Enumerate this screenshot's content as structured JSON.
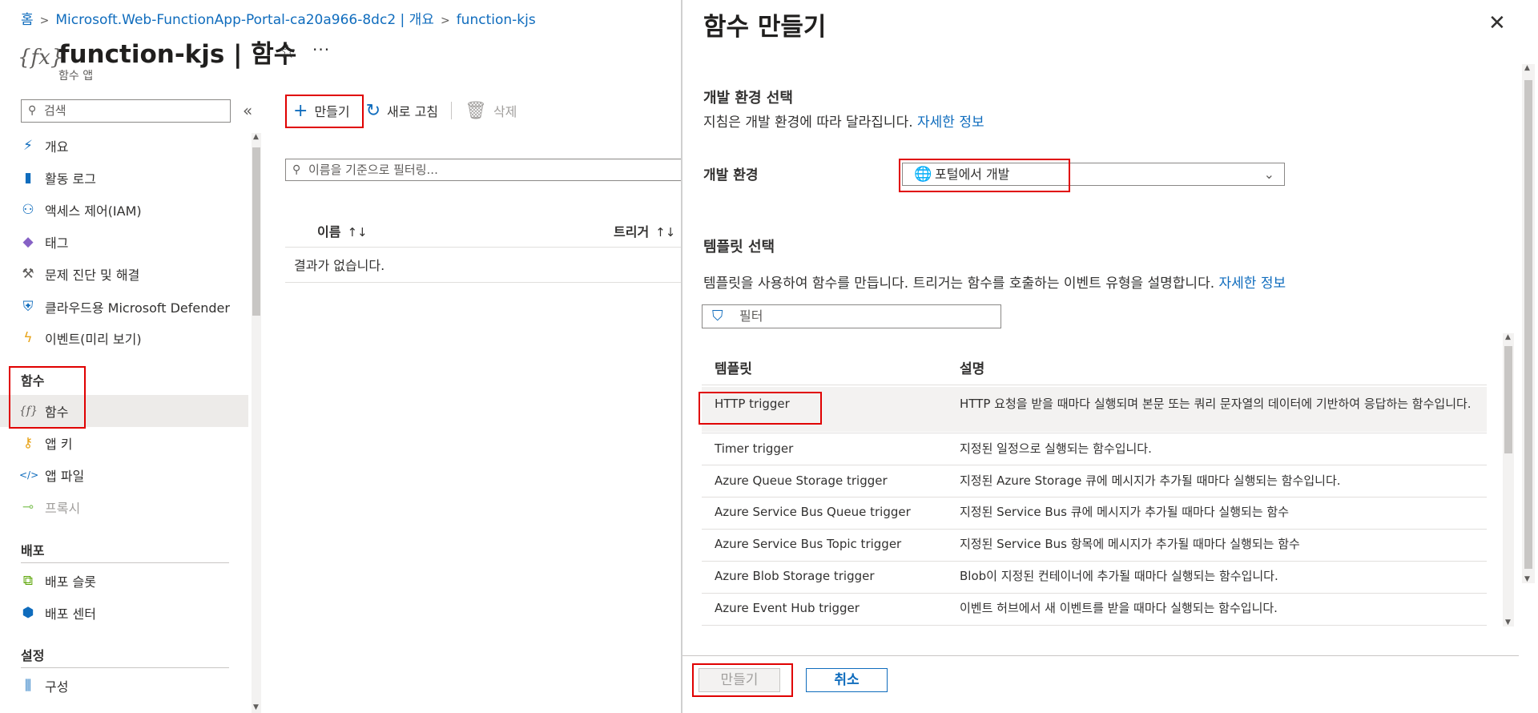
{
  "breadcrumb": {
    "home": "홈",
    "resource": "Microsoft.Web-FunctionApp-Portal-ca20a966-8dc2 | 개요",
    "current": "function-kjs"
  },
  "app": {
    "icon": "function-icon",
    "title": "function-kjs | 함수",
    "subtitle": "함수 앱"
  },
  "sidebar": {
    "search_placeholder": "검색",
    "items": [
      {
        "label": "개요",
        "icon": "lightning-icon"
      },
      {
        "label": "활동 로그",
        "icon": "log-icon"
      },
      {
        "label": "액세스 제어(IAM)",
        "icon": "people-icon"
      },
      {
        "label": "태그",
        "icon": "tag-icon"
      },
      {
        "label": "문제 진단 및 해결",
        "icon": "wrench-icon"
      },
      {
        "label": "클라우드용 Microsoft Defender",
        "icon": "shield-icon"
      },
      {
        "label": "이벤트(미리 보기)",
        "icon": "bolt-icon"
      }
    ],
    "groups": [
      {
        "label": "함수",
        "items": [
          {
            "label": "함수",
            "icon": "function-icon",
            "selected": true
          },
          {
            "label": "앱 키",
            "icon": "key-icon"
          },
          {
            "label": "앱 파일",
            "icon": "code-file-icon"
          },
          {
            "label": "프록시",
            "icon": "proxy-icon",
            "disabled": true
          }
        ]
      },
      {
        "label": "배포",
        "items": [
          {
            "label": "배포 슬롯",
            "icon": "slots-icon"
          },
          {
            "label": "배포 센터",
            "icon": "cube-icon"
          }
        ]
      },
      {
        "label": "설정",
        "items": [
          {
            "label": "구성",
            "icon": "settings-bars-icon"
          }
        ]
      }
    ]
  },
  "toolbar": {
    "create": "만들기",
    "refresh": "새로 고침",
    "delete": "삭제"
  },
  "list": {
    "filter_placeholder": "이름을 기준으로 필터링...",
    "col_name": "이름",
    "col_trigger": "트리거",
    "empty": "결과가 없습니다."
  },
  "panel": {
    "title": "함수 만들기",
    "env_heading": "개발 환경 선택",
    "env_desc": "지침은 개발 환경에 따라 달라집니다.",
    "more_info": "자세한 정보",
    "env_label": "개발 환경",
    "env_value": "포털에서 개발",
    "tpl_heading": "템플릿 선택",
    "tpl_desc": "템플릿을 사용하여 함수를 만듭니다. 트리거는 함수를 호출하는 이벤트 유형을 설명합니다.",
    "filter_placeholder": "필터",
    "col_template": "템플릿",
    "col_desc": "설명",
    "templates": [
      {
        "name": "HTTP trigger",
        "desc": "HTTP 요청을 받을 때마다 실행되며 본문 또는 쿼리 문자열의 데이터에 기반하여 응답하는 함수입니다."
      },
      {
        "name": "Timer trigger",
        "desc": "지정된 일정으로 실행되는 함수입니다."
      },
      {
        "name": "Azure Queue Storage trigger",
        "desc": "지정된 Azure Storage 큐에 메시지가 추가될 때마다 실행되는 함수입니다."
      },
      {
        "name": "Azure Service Bus Queue trigger",
        "desc": "지정된 Service Bus 큐에 메시지가 추가될 때마다 실행되는 함수"
      },
      {
        "name": "Azure Service Bus Topic trigger",
        "desc": "지정된 Service Bus 항목에 메시지가 추가될 때마다 실행되는 함수"
      },
      {
        "name": "Azure Blob Storage trigger",
        "desc": "Blob이 지정된 컨테이너에 추가될 때마다 실행되는 함수입니다."
      },
      {
        "name": "Azure Event Hub trigger",
        "desc": "이벤트 허브에서 새 이벤트를 받을 때마다 실행되는 함수입니다."
      }
    ],
    "btn_create": "만들기",
    "btn_cancel": "취소"
  },
  "colors": {
    "accent": "#0f6cbd",
    "highlight": "#e00000"
  }
}
